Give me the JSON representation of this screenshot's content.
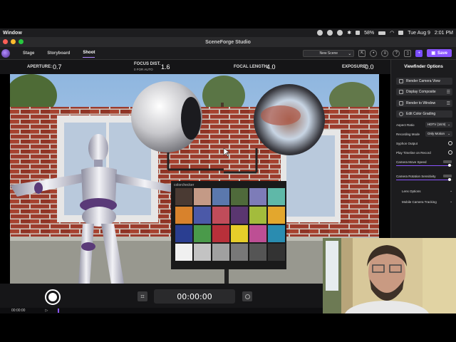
{
  "menubar": {
    "app": "Window",
    "date": "Tue Aug 9",
    "time": "2:01 PM",
    "battery": "58%"
  },
  "window": {
    "title": "SceneForge Studio"
  },
  "toolbar": {
    "tabs": [
      {
        "label": "Stage"
      },
      {
        "label": "Storyboard"
      },
      {
        "label": "Shoot"
      }
    ],
    "scene_select": "New Scene",
    "save_label": "Save"
  },
  "camera": {
    "aperture_label": "APERTURE:",
    "aperture_value": "0.7",
    "focus_label": "FOCUS DIST.",
    "focus_sub": "0 FOR AUTO",
    "focus_value": "1.6",
    "focal_label": "FOCAL LENGTH:",
    "focal_value": "4.0",
    "exposure_label": "EXPOSURE:",
    "exposure_value": "0.0"
  },
  "viewport": {
    "chart_brand": "colorchecker"
  },
  "transport": {
    "timecode": "00:00:00"
  },
  "timeline": {
    "time": "00:00:00"
  },
  "panel": {
    "title": "Viewfinder Options",
    "buttons": {
      "render_camera": "Render Camera View",
      "display_composite": "Display Composite",
      "render_window": "Render to Window",
      "edit_grading": "Edit Color Grading"
    },
    "aspect_label": "Aspect Ratio",
    "aspect_value": "HDTV (16:9)",
    "recording_label": "Recording Mode",
    "recording_value": "Only Motion",
    "syphon_label": "Syphon Output",
    "play_label": "Play Timeline on Record",
    "move_speed_label": "Camera Move Speed",
    "move_speed_level": 0.95,
    "rotation_label": "Camera Rotation Sensitivity",
    "rotation_level": 0.95,
    "lens_label": "Lens Options",
    "tracking_label": "Mobile Camera Tracking"
  },
  "colors": {
    "accent": "#8a55ff",
    "checker": [
      "#4a3a33",
      "#c49a86",
      "#5b78ad",
      "#4f6a3b",
      "#7d7cb8",
      "#5fb8a8",
      "#d8822c",
      "#4b59a8",
      "#c04c5a",
      "#5a3670",
      "#a3bc3c",
      "#e3a72d",
      "#2a3e91",
      "#4a9a4a",
      "#b8303a",
      "#e6cd2a",
      "#bd4f94",
      "#2a8cb0",
      "#f0f0f0",
      "#c3c3c3",
      "#a0a0a0",
      "#787878",
      "#555555",
      "#333333"
    ]
  }
}
